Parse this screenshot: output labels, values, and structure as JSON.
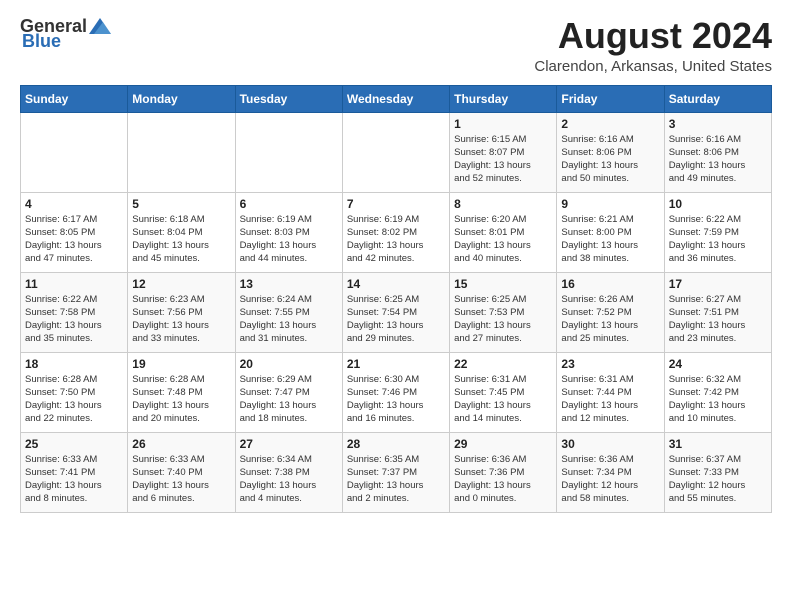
{
  "header": {
    "logo_general": "General",
    "logo_blue": "Blue",
    "month_year": "August 2024",
    "location": "Clarendon, Arkansas, United States"
  },
  "weekdays": [
    "Sunday",
    "Monday",
    "Tuesday",
    "Wednesday",
    "Thursday",
    "Friday",
    "Saturday"
  ],
  "weeks": [
    [
      {
        "num": "",
        "detail": ""
      },
      {
        "num": "",
        "detail": ""
      },
      {
        "num": "",
        "detail": ""
      },
      {
        "num": "",
        "detail": ""
      },
      {
        "num": "1",
        "detail": "Sunrise: 6:15 AM\nSunset: 8:07 PM\nDaylight: 13 hours\nand 52 minutes."
      },
      {
        "num": "2",
        "detail": "Sunrise: 6:16 AM\nSunset: 8:06 PM\nDaylight: 13 hours\nand 50 minutes."
      },
      {
        "num": "3",
        "detail": "Sunrise: 6:16 AM\nSunset: 8:06 PM\nDaylight: 13 hours\nand 49 minutes."
      }
    ],
    [
      {
        "num": "4",
        "detail": "Sunrise: 6:17 AM\nSunset: 8:05 PM\nDaylight: 13 hours\nand 47 minutes."
      },
      {
        "num": "5",
        "detail": "Sunrise: 6:18 AM\nSunset: 8:04 PM\nDaylight: 13 hours\nand 45 minutes."
      },
      {
        "num": "6",
        "detail": "Sunrise: 6:19 AM\nSunset: 8:03 PM\nDaylight: 13 hours\nand 44 minutes."
      },
      {
        "num": "7",
        "detail": "Sunrise: 6:19 AM\nSunset: 8:02 PM\nDaylight: 13 hours\nand 42 minutes."
      },
      {
        "num": "8",
        "detail": "Sunrise: 6:20 AM\nSunset: 8:01 PM\nDaylight: 13 hours\nand 40 minutes."
      },
      {
        "num": "9",
        "detail": "Sunrise: 6:21 AM\nSunset: 8:00 PM\nDaylight: 13 hours\nand 38 minutes."
      },
      {
        "num": "10",
        "detail": "Sunrise: 6:22 AM\nSunset: 7:59 PM\nDaylight: 13 hours\nand 36 minutes."
      }
    ],
    [
      {
        "num": "11",
        "detail": "Sunrise: 6:22 AM\nSunset: 7:58 PM\nDaylight: 13 hours\nand 35 minutes."
      },
      {
        "num": "12",
        "detail": "Sunrise: 6:23 AM\nSunset: 7:56 PM\nDaylight: 13 hours\nand 33 minutes."
      },
      {
        "num": "13",
        "detail": "Sunrise: 6:24 AM\nSunset: 7:55 PM\nDaylight: 13 hours\nand 31 minutes."
      },
      {
        "num": "14",
        "detail": "Sunrise: 6:25 AM\nSunset: 7:54 PM\nDaylight: 13 hours\nand 29 minutes."
      },
      {
        "num": "15",
        "detail": "Sunrise: 6:25 AM\nSunset: 7:53 PM\nDaylight: 13 hours\nand 27 minutes."
      },
      {
        "num": "16",
        "detail": "Sunrise: 6:26 AM\nSunset: 7:52 PM\nDaylight: 13 hours\nand 25 minutes."
      },
      {
        "num": "17",
        "detail": "Sunrise: 6:27 AM\nSunset: 7:51 PM\nDaylight: 13 hours\nand 23 minutes."
      }
    ],
    [
      {
        "num": "18",
        "detail": "Sunrise: 6:28 AM\nSunset: 7:50 PM\nDaylight: 13 hours\nand 22 minutes."
      },
      {
        "num": "19",
        "detail": "Sunrise: 6:28 AM\nSunset: 7:48 PM\nDaylight: 13 hours\nand 20 minutes."
      },
      {
        "num": "20",
        "detail": "Sunrise: 6:29 AM\nSunset: 7:47 PM\nDaylight: 13 hours\nand 18 minutes."
      },
      {
        "num": "21",
        "detail": "Sunrise: 6:30 AM\nSunset: 7:46 PM\nDaylight: 13 hours\nand 16 minutes."
      },
      {
        "num": "22",
        "detail": "Sunrise: 6:31 AM\nSunset: 7:45 PM\nDaylight: 13 hours\nand 14 minutes."
      },
      {
        "num": "23",
        "detail": "Sunrise: 6:31 AM\nSunset: 7:44 PM\nDaylight: 13 hours\nand 12 minutes."
      },
      {
        "num": "24",
        "detail": "Sunrise: 6:32 AM\nSunset: 7:42 PM\nDaylight: 13 hours\nand 10 minutes."
      }
    ],
    [
      {
        "num": "25",
        "detail": "Sunrise: 6:33 AM\nSunset: 7:41 PM\nDaylight: 13 hours\nand 8 minutes."
      },
      {
        "num": "26",
        "detail": "Sunrise: 6:33 AM\nSunset: 7:40 PM\nDaylight: 13 hours\nand 6 minutes."
      },
      {
        "num": "27",
        "detail": "Sunrise: 6:34 AM\nSunset: 7:38 PM\nDaylight: 13 hours\nand 4 minutes."
      },
      {
        "num": "28",
        "detail": "Sunrise: 6:35 AM\nSunset: 7:37 PM\nDaylight: 13 hours\nand 2 minutes."
      },
      {
        "num": "29",
        "detail": "Sunrise: 6:36 AM\nSunset: 7:36 PM\nDaylight: 13 hours\nand 0 minutes."
      },
      {
        "num": "30",
        "detail": "Sunrise: 6:36 AM\nSunset: 7:34 PM\nDaylight: 12 hours\nand 58 minutes."
      },
      {
        "num": "31",
        "detail": "Sunrise: 6:37 AM\nSunset: 7:33 PM\nDaylight: 12 hours\nand 55 minutes."
      }
    ]
  ]
}
